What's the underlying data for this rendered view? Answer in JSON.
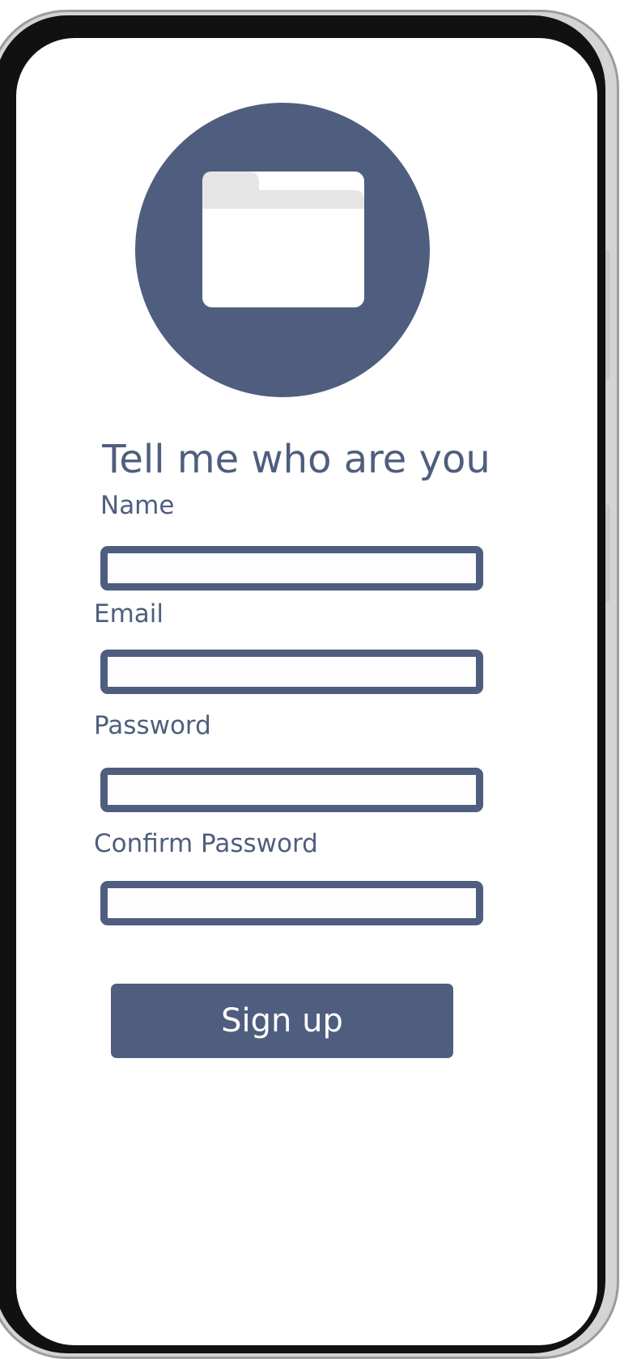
{
  "profile": {
    "icon": "folder-icon"
  },
  "signup": {
    "title": "Tell me who are you",
    "name_label": "Name",
    "email_label": "Email",
    "password_label": "Password",
    "confirm_password_label": "Confirm Password",
    "name_value": "",
    "email_value": "",
    "password_value": "",
    "confirm_password_value": "",
    "submit_label": "Sign up"
  },
  "colors": {
    "accent": "#4f5e7e",
    "background": "#ffffff",
    "folder_tab": "#e6e6e6"
  }
}
